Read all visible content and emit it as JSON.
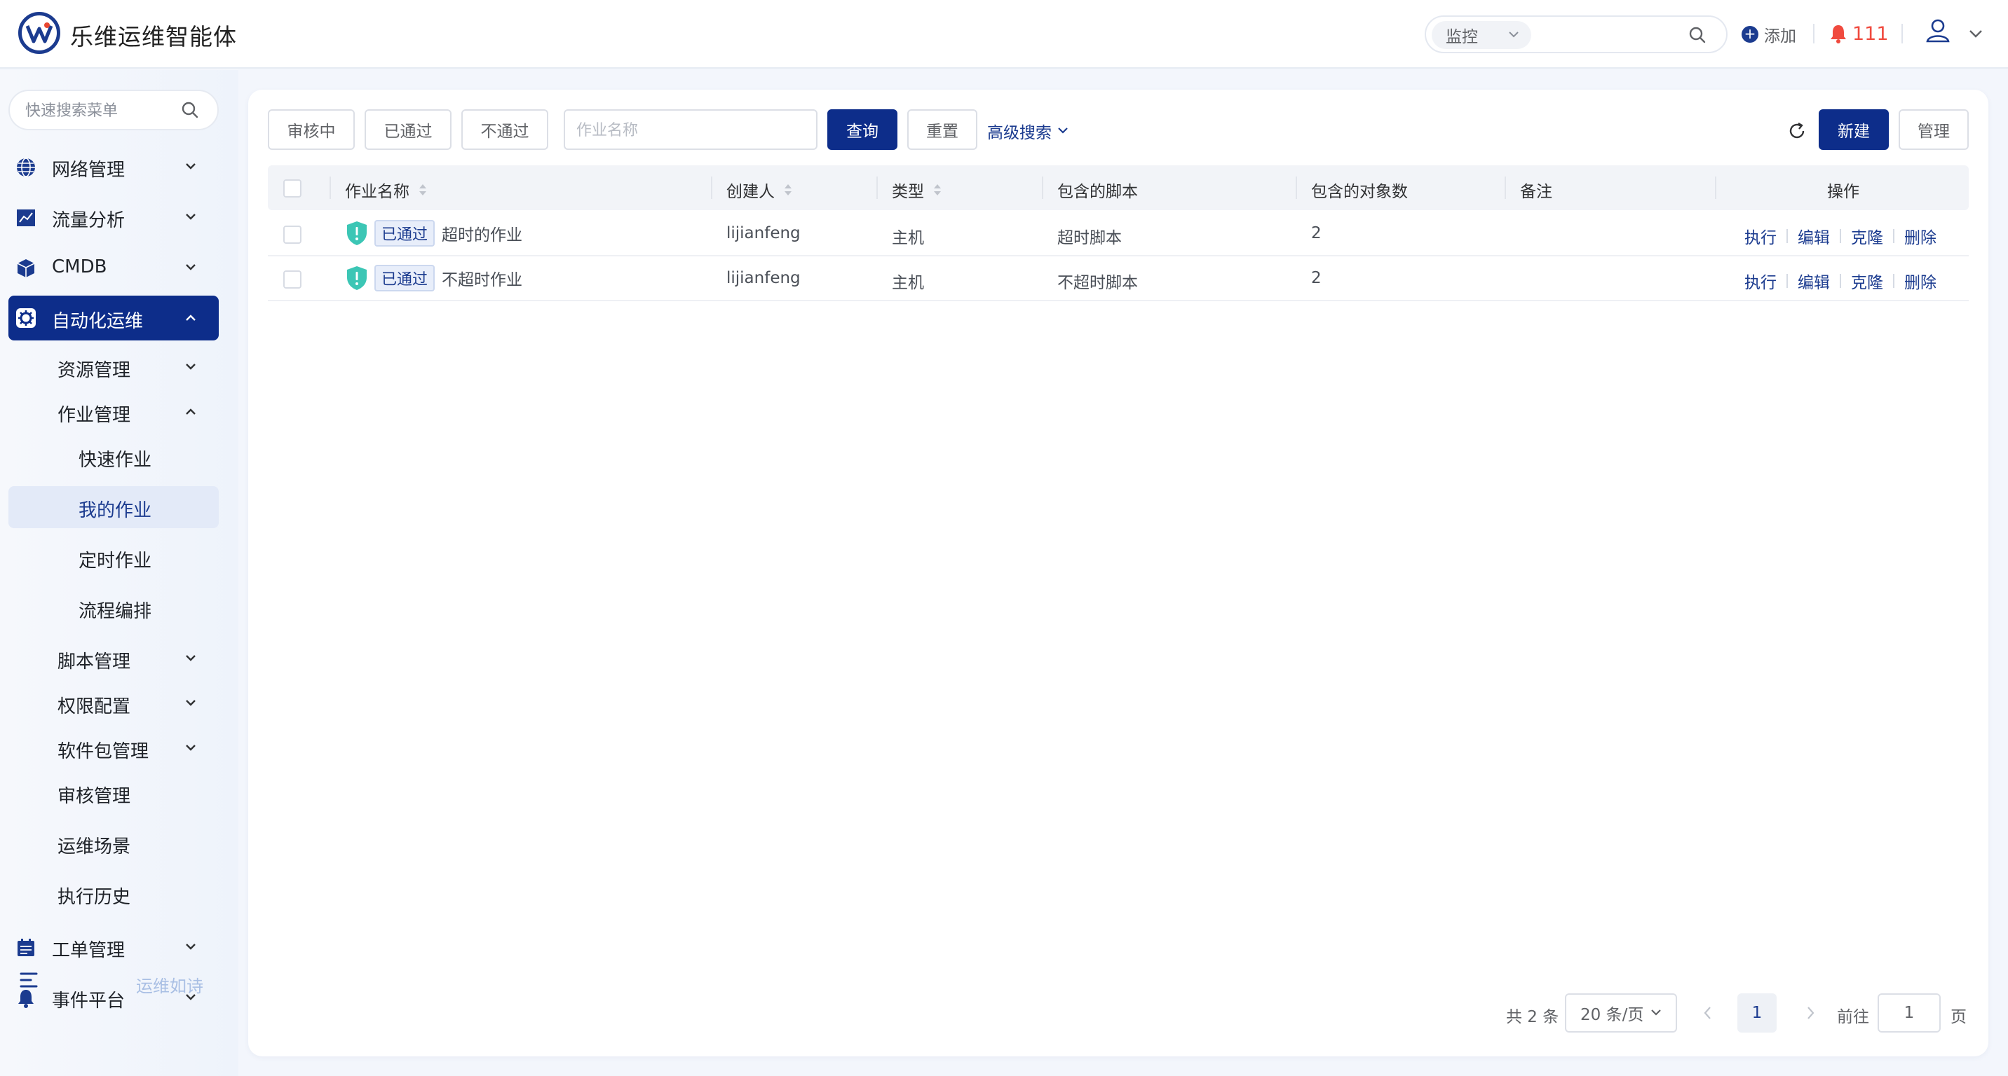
{
  "app": {
    "title": "乐维运维智能体"
  },
  "header": {
    "search_scope": "监控",
    "search_placeholder": "",
    "add_label": "添加",
    "alert_count": "111",
    "colors": {
      "alert": "#f04a3e",
      "brand": "#0d2d8a"
    }
  },
  "sidebar": {
    "search_placeholder": "快速搜索菜单",
    "items": [
      {
        "label": "网络管理",
        "icon": "globe-icon",
        "expanded": false
      },
      {
        "label": "流量分析",
        "icon": "line-chart-icon",
        "expanded": false
      },
      {
        "label": "CMDB",
        "icon": "cube-icon",
        "expanded": false
      },
      {
        "label": "自动化运维",
        "icon": "gear-icon",
        "expanded": true,
        "active": true
      },
      {
        "label": "工单管理",
        "icon": "calendar-icon",
        "expanded": false
      },
      {
        "label": "事件平台",
        "icon": "bell-icon",
        "expanded": false
      }
    ],
    "sub": {
      "resource": "资源管理",
      "job": "作业管理",
      "quick_job": "快速作业",
      "my_job": "我的作业",
      "scheduled_job": "定时作业",
      "flow": "流程编排",
      "script": "脚本管理",
      "permission": "权限配置",
      "package": "软件包管理",
      "audit": "审核管理",
      "scene": "运维场景",
      "history": "执行历史"
    },
    "footer_text": "运维如诗"
  },
  "toolbar": {
    "filter_pending": "审核中",
    "filter_passed": "已通过",
    "filter_rejected": "不通过",
    "name_placeholder": "作业名称",
    "query": "查询",
    "reset": "重置",
    "advanced": "高级搜索",
    "new": "新建",
    "manage": "管理"
  },
  "table": {
    "headers": {
      "name": "作业名称",
      "creator": "创建人",
      "type": "类型",
      "scripts": "包含的脚本",
      "targets": "包含的对象数",
      "remark": "备注",
      "actions": "操作"
    },
    "rows": [
      {
        "status": "已通过",
        "name": "超时的作业",
        "creator": "lijianfeng",
        "type": "主机",
        "scripts": "超时脚本",
        "targets": "2",
        "remark": ""
      },
      {
        "status": "已通过",
        "name": "不超时作业",
        "creator": "lijianfeng",
        "type": "主机",
        "scripts": "不超时脚本",
        "targets": "2",
        "remark": ""
      }
    ],
    "actions": {
      "run": "执行",
      "edit": "编辑",
      "clone": "克隆",
      "delete": "删除"
    }
  },
  "pagination": {
    "total": "共 2 条",
    "page_size": "20 条/页",
    "current": "1",
    "goto_label": "前往",
    "goto_value": "1",
    "page_suffix": "页"
  }
}
